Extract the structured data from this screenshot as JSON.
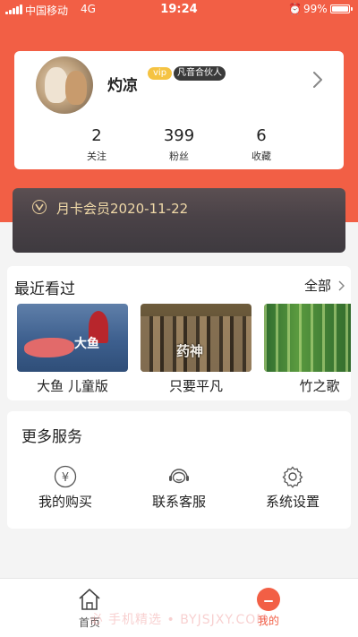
{
  "status_bar": {
    "carrier": "中国移动",
    "network": "4G",
    "time": "19:24",
    "battery": "99%",
    "battery_level": 0.99
  },
  "profile": {
    "username": "灼凉",
    "vip_badge": "vip",
    "partner_badge": "凡音合伙人",
    "stats": [
      {
        "value": "2",
        "label": "关注"
      },
      {
        "value": "399",
        "label": "粉丝"
      },
      {
        "value": "6",
        "label": "收藏"
      }
    ]
  },
  "membership": {
    "text": "月卡会员2020-11-22"
  },
  "recent": {
    "title": "最近看过",
    "all_label": "全部",
    "items": [
      {
        "name": "大鱼 儿童版",
        "poster_text": "大鱼"
      },
      {
        "name": "只要平凡",
        "poster_text": "药神"
      },
      {
        "name": "竹之歌",
        "poster_text": ""
      }
    ]
  },
  "services": {
    "title": "更多服务",
    "items": [
      {
        "label": "我的购买",
        "icon": "yuan-icon"
      },
      {
        "label": "联系客服",
        "icon": "customer-service-icon"
      },
      {
        "label": "系统设置",
        "icon": "settings-gear-icon"
      }
    ]
  },
  "tab_bar": {
    "home": "首页",
    "me": "我的"
  },
  "watermark": "必  手机精选 • BYJSJXY.COM",
  "colors": {
    "brand": "#f25f45",
    "vip_gold": "#f0d9a8",
    "vip_card": "#4a4247"
  }
}
